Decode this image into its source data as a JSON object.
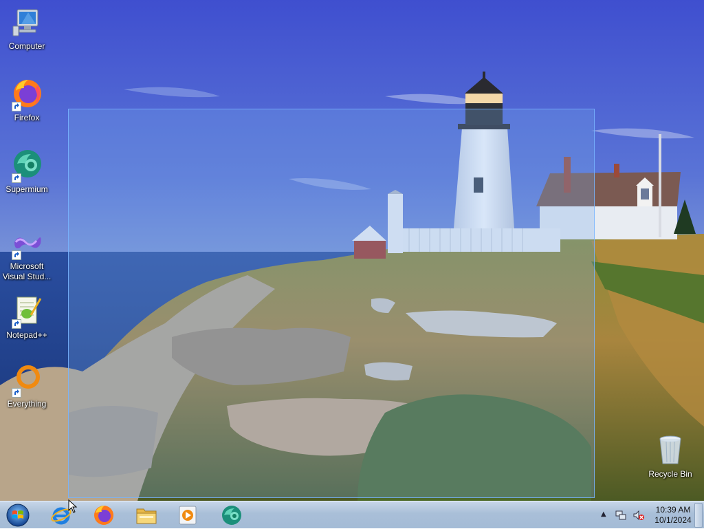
{
  "desktop": {
    "icons": [
      {
        "label": "Computer",
        "icon": "computer-icon"
      },
      {
        "label": "Firefox",
        "icon": "firefox-icon"
      },
      {
        "label": "Supermium",
        "icon": "supermium-icon"
      },
      {
        "label": "Microsoft Visual Stud...",
        "icon": "visual-studio-icon"
      },
      {
        "label": "Notepad++",
        "icon": "notepad-plus-plus-icon"
      },
      {
        "label": "Everything",
        "icon": "everything-search-icon"
      }
    ],
    "recycle_bin": {
      "label": "Recycle Bin",
      "icon": "recycle-bin-icon"
    }
  },
  "taskbar": {
    "start_icon": "windows-start-icon",
    "pinned": [
      {
        "name": "internet-explorer",
        "icon": "internet-explorer-icon"
      },
      {
        "name": "firefox",
        "icon": "firefox-icon"
      },
      {
        "name": "file-explorer",
        "icon": "folder-icon"
      },
      {
        "name": "media-player",
        "icon": "media-player-icon"
      },
      {
        "name": "supermium",
        "icon": "supermium-icon"
      }
    ],
    "tray": {
      "show_hidden_icon": "▲",
      "network_icon": "network-icon",
      "volume_icon": "volume-muted-icon"
    },
    "clock": {
      "time": "10:39 AM",
      "date": "10/1/2024"
    }
  },
  "colors": {
    "sky": "#4a5fd0",
    "selection": "#78aaeb",
    "taskbar": "#a9bfd8"
  }
}
